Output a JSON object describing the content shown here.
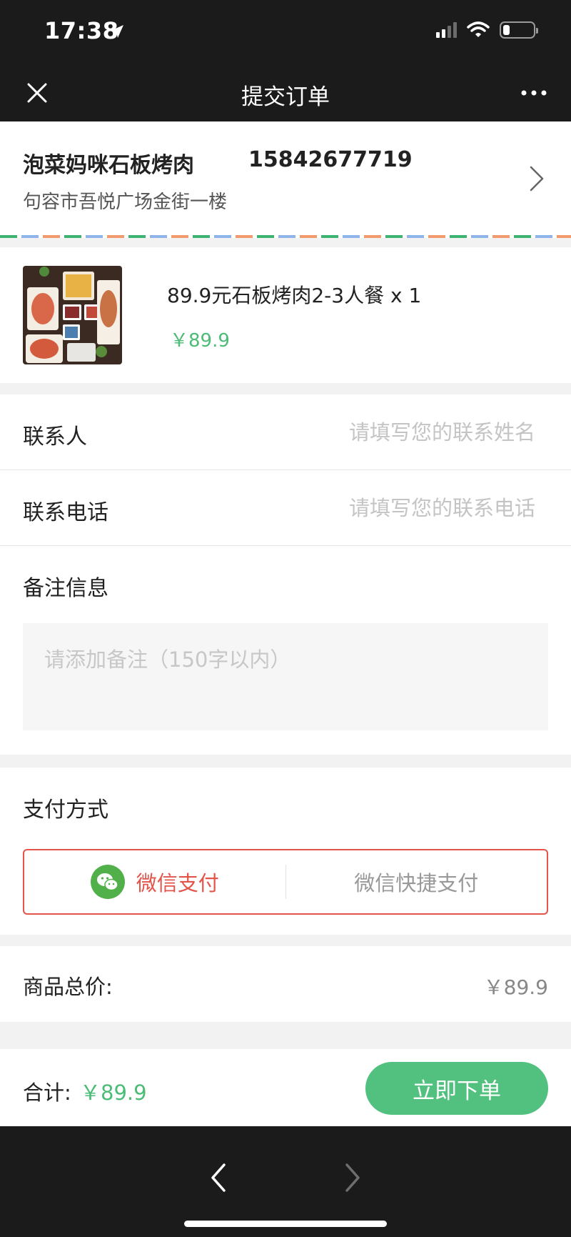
{
  "status": {
    "time": "17:38"
  },
  "nav": {
    "title": "提交订单"
  },
  "store": {
    "name": "泡菜妈咪石板烤肉",
    "phone": "15842677719",
    "address": "句容市吾悦广场金街一楼"
  },
  "product": {
    "name": "89.9元石板烤肉2-3人餐 x 1",
    "price": "￥89.9"
  },
  "form": {
    "contact_label": "联系人",
    "contact_placeholder": "请填写您的联系姓名",
    "phone_label": "联系电话",
    "phone_placeholder": "请填写您的联系电话",
    "remark_label": "备注信息",
    "remark_placeholder": "请添加备注（150字以内）"
  },
  "payment": {
    "label": "支付方式",
    "options": [
      {
        "label": "微信支付",
        "selected": true
      },
      {
        "label": "微信快捷支付",
        "selected": false
      }
    ]
  },
  "total": {
    "label": "商品总价:",
    "value": "￥89.9"
  },
  "bottom": {
    "sum_label": "合计:",
    "sum_value": "￥89.9",
    "order_button": "立即下单"
  },
  "colors": {
    "accent_green": "#52c07e",
    "price_green": "#4cbc76",
    "pay_red": "#e3554a",
    "dark_bar": "#1b1b1b"
  },
  "icons": [
    "location-arrow-icon",
    "signal-icon",
    "wifi-icon",
    "battery-icon",
    "close-icon",
    "more-icon",
    "chevron-right-icon",
    "wechat-pay-icon",
    "back-arrow-icon",
    "forward-arrow-icon"
  ]
}
